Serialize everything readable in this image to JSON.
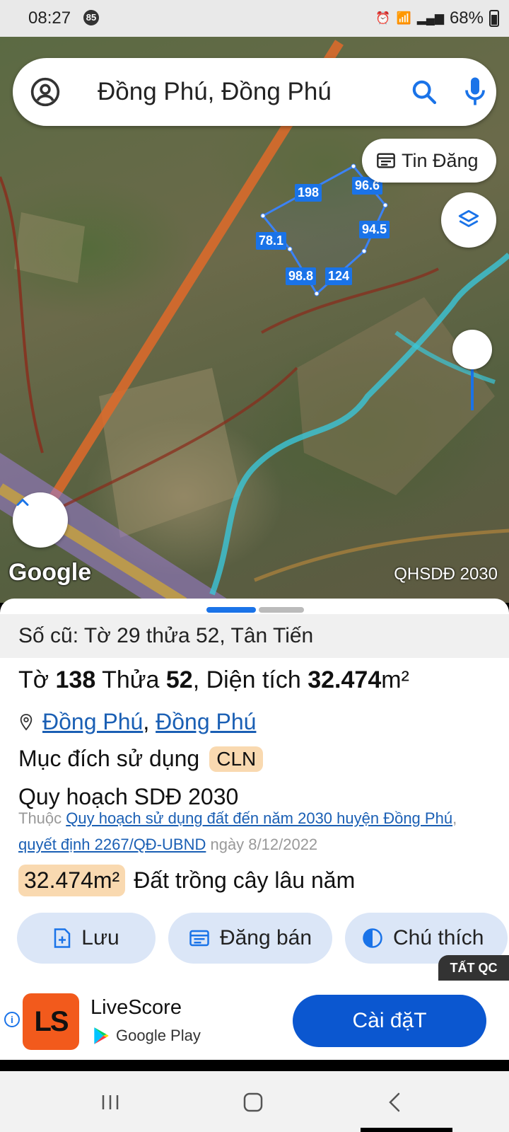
{
  "status_bar": {
    "time": "08:27",
    "notif_badge": "85",
    "battery": "68%"
  },
  "search": {
    "query": "Đồng Phú, Đồng Phú"
  },
  "map": {
    "tin_dang_label": "Tin Đăng",
    "attribution": "Google",
    "layer_label": "QHSDĐ 2030",
    "edge_lengths": [
      "198",
      "96.6",
      "94.5",
      "124",
      "98.8",
      "78.1"
    ]
  },
  "sheet": {
    "old_label": "Số cũ: Tờ 29 thửa 52, Tân Tiến",
    "to_word": "Tờ ",
    "to_num": "138",
    "thua_word": " Thửa ",
    "thua_num": "52",
    "dt_word": ", Diện tích ",
    "area": "32.474",
    "area_unit": "m²",
    "loc_1": "Đồng Phú",
    "loc_sep": ",",
    "loc_2": "Đồng Phú",
    "purpose_label": "Mục đích sử dụng",
    "purpose_code": "CLN",
    "plan_title": "Quy hoạch SDĐ 2030",
    "note_prefix": "Thuộc ",
    "note_link1": "Quy hoạch sử dụng đất đến năm 2030 huyện Đồng Phú",
    "note_sep": ", ",
    "note_link2": "quyết định 2267/QĐ-UBND",
    "note_suffix": " ngày 8/12/2022",
    "area_chip": "32.474m²",
    "area_type": "Đất trồng cây lâu năm",
    "actions": {
      "save": "Lưu",
      "post": "Đăng bán",
      "legend": "Chú thích"
    },
    "ads_off": "TẤT QC"
  },
  "ad": {
    "app_name": "LiveScore",
    "store": "Google Play",
    "logo_text": "LS",
    "install": "Cài đặT"
  }
}
